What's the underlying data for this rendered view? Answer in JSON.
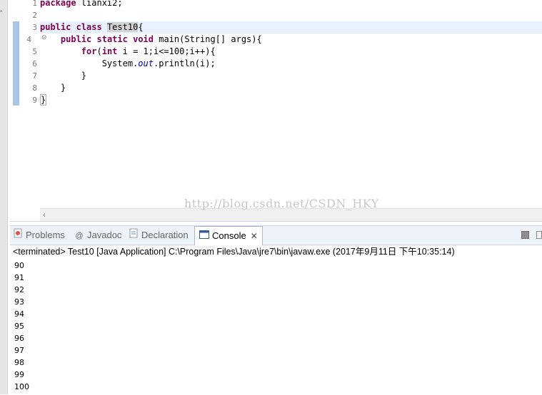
{
  "editor": {
    "line_numbers": [
      "1",
      "2",
      "3",
      "4",
      "5",
      "6",
      "7",
      "8",
      "9"
    ],
    "lines": [
      {
        "k1": "package",
        "t1": " lianxi2;"
      },
      {},
      {
        "k1": "public",
        "s1": " ",
        "k2": "class",
        "s2": " ",
        "hl": "Test10",
        "t1": "{"
      },
      {
        "ind": "    ",
        "k1": "public",
        "s1": " ",
        "k2": "static",
        "s2": " ",
        "k3": "void",
        "t1": " main(String[] args){"
      },
      {
        "ind": "        ",
        "k1": "for",
        "t1": "(",
        "k2": "int",
        "t2": " i = 1;i<=100;i++){"
      },
      {
        "ind": "            ",
        "t1": "System.",
        "fld": "out",
        "t2": ".println(i);"
      },
      {
        "t1": "        }"
      },
      {
        "t1": "    }"
      },
      {
        "brk": "}"
      }
    ],
    "watermark": "http://blog.csdn.net/CSDN_HKY"
  },
  "panel": {
    "tabs": [
      {
        "label": "Problems"
      },
      {
        "label": "Javadoc"
      },
      {
        "label": "Declaration"
      },
      {
        "label": "Console"
      }
    ],
    "status": "<terminated> Test10 [Java Application] C:\\Program Files\\Java\\jre7\\bin\\javaw.exe (2017年9月11日 下午10:35:14)",
    "output": [
      "90",
      "91",
      "92",
      "93",
      "94",
      "95",
      "96",
      "97",
      "98",
      "99",
      "100"
    ]
  },
  "colors": {
    "keyword": "#7f0055",
    "field": "#0000c0",
    "marker": "#a9c5e6",
    "current_line": "#e8f2fe"
  }
}
